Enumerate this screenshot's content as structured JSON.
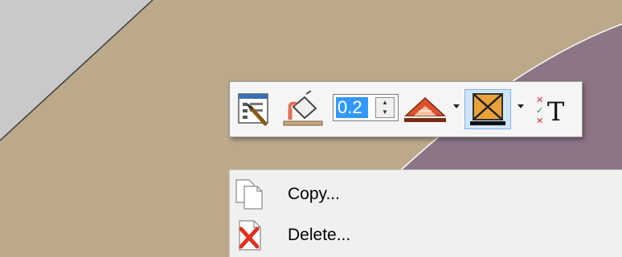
{
  "toolbar": {
    "buttons": [
      {
        "name": "element-properties-button",
        "icon": "properties-wrench-icon"
      },
      {
        "name": "fill-paint-bucket-button",
        "icon": "paint-bucket-icon"
      },
      {
        "name": "line-style-button",
        "icon": "triangle-pattern-icon",
        "has_dropdown": true
      },
      {
        "name": "fill-pattern-button",
        "icon": "crossed-box-icon",
        "has_dropdown": true,
        "active": true
      },
      {
        "name": "text-toggle-button",
        "icon": "check-x-text-icon"
      }
    ],
    "spin_value": "0.2"
  },
  "context_menu": {
    "items": [
      {
        "label": "Copy...",
        "icon": "copy-pages-icon"
      },
      {
        "label": "Delete...",
        "icon": "delete-document-icon"
      }
    ]
  },
  "colors": {
    "canvas_tan": "#bca98a",
    "canvas_mauve": "#8a7485",
    "canvas_grey": "#c6c6c6",
    "selection_blue": "#3399ff"
  }
}
